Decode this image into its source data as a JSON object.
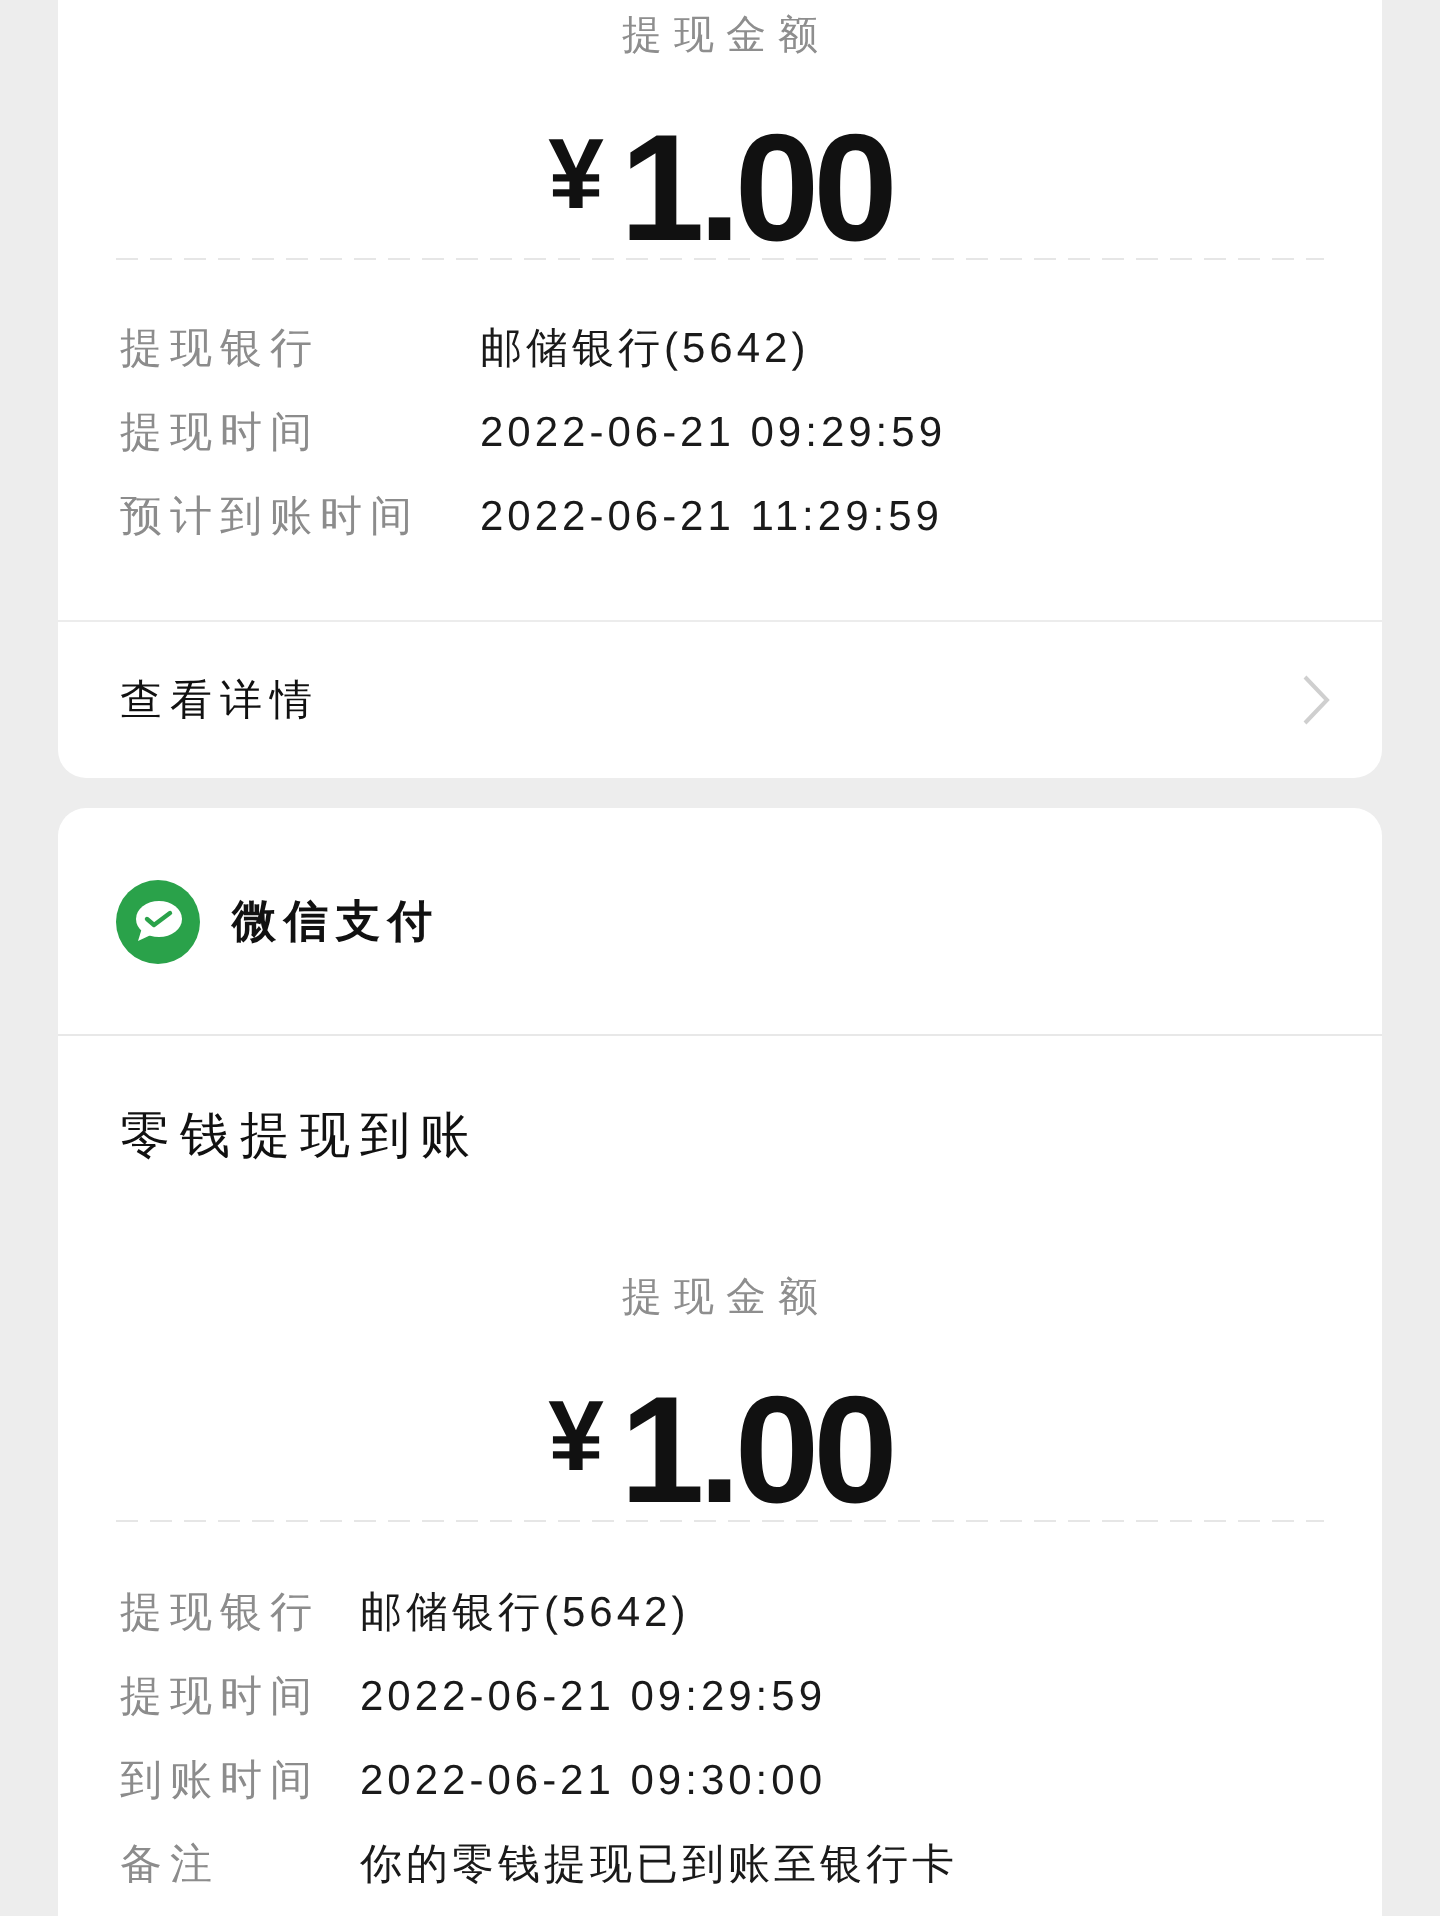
{
  "cards": [
    {
      "kind": "receipt",
      "amount_label": "提现金额",
      "currency": "¥",
      "amount": "1.00",
      "details": [
        {
          "label": "提现银行",
          "value": "邮储银行(5642)"
        },
        {
          "label": "提现时间",
          "value": "2022-06-21 09:29:59"
        },
        {
          "label": "预计到账时间",
          "value": "2022-06-21 11:29:59"
        }
      ],
      "link": {
        "label": "查看详情"
      }
    },
    {
      "kind": "notification",
      "app": {
        "name": "微信支付"
      },
      "title": "零钱提现到账",
      "amount_label": "提现金额",
      "currency": "¥",
      "amount": "1.00",
      "details": [
        {
          "label": "提现银行",
          "value": "邮储银行(5642)"
        },
        {
          "label": "提现时间",
          "value": "2022-06-21 09:29:59"
        },
        {
          "label": "到账时间",
          "value": "2022-06-21 09:30:00"
        },
        {
          "label": "备注",
          "value": "你的零钱提现已到账至银行卡"
        }
      ]
    }
  ]
}
